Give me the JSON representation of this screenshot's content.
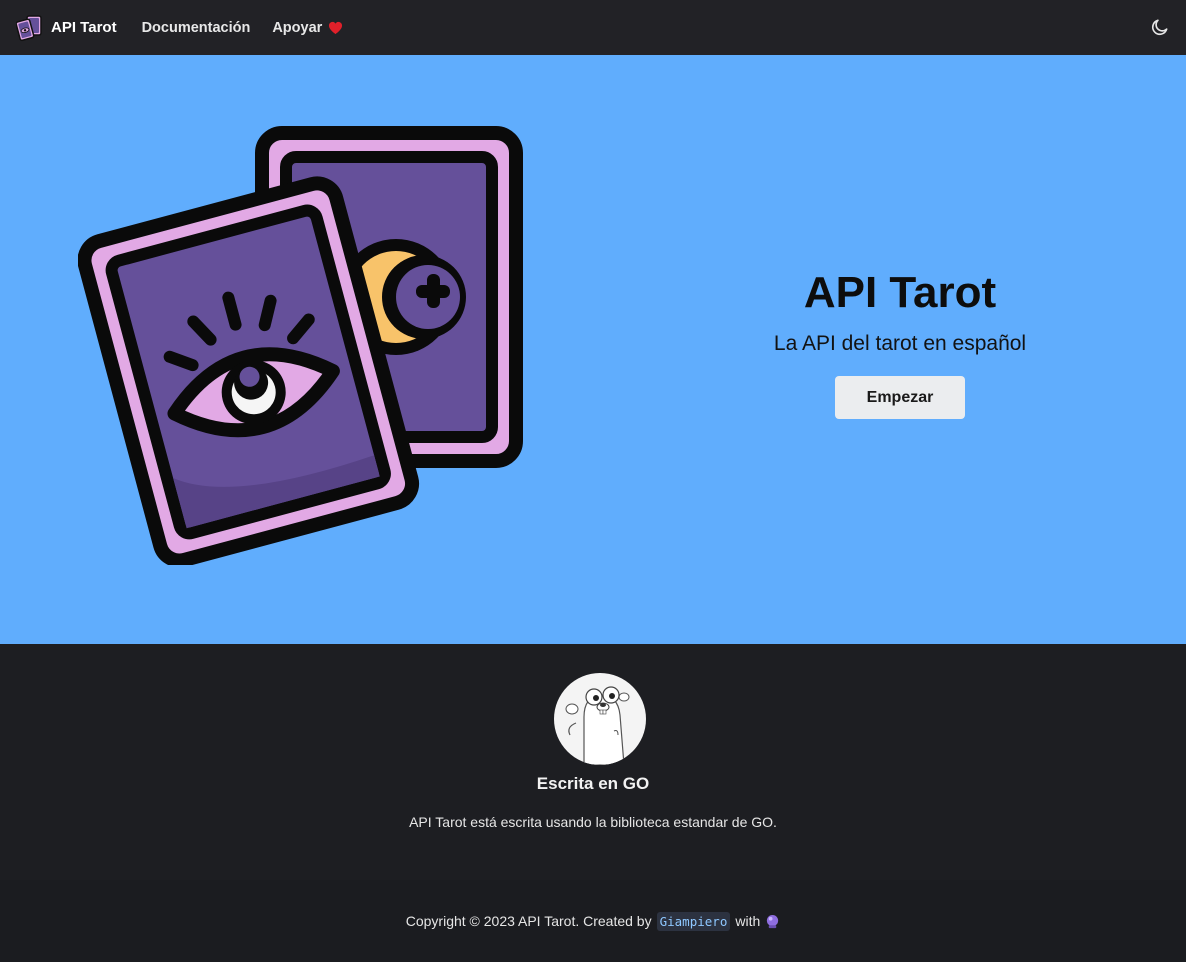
{
  "navbar": {
    "brand_title": "API Tarot",
    "links": [
      {
        "label": "Documentación"
      },
      {
        "label": "Apoyar"
      }
    ],
    "icons": {
      "logo": "tarot-cards-icon",
      "heart": "heart-icon",
      "theme": "moon-icon"
    }
  },
  "hero": {
    "title": "API Tarot",
    "subtitle": "La API del tarot en español",
    "button_label": "Empezar",
    "illustration": "tarot-cards-illustration",
    "background": "#60adfd"
  },
  "feature": {
    "image": "gopher-avatar",
    "title": "Escrita en GO",
    "description": "API Tarot está escrita usando la biblioteca estandar de GO."
  },
  "footer": {
    "copyright_prefix": "Copyright © 2023 API Tarot. Created by",
    "author": "Giampiero",
    "suffix": "with",
    "icon": "crystal-ball-icon"
  },
  "colors": {
    "navbar": "#222226",
    "hero": "#60adfd",
    "footer": "#1d1e22",
    "card_purple": "#65509a",
    "card_pink": "#e2a9e5"
  }
}
